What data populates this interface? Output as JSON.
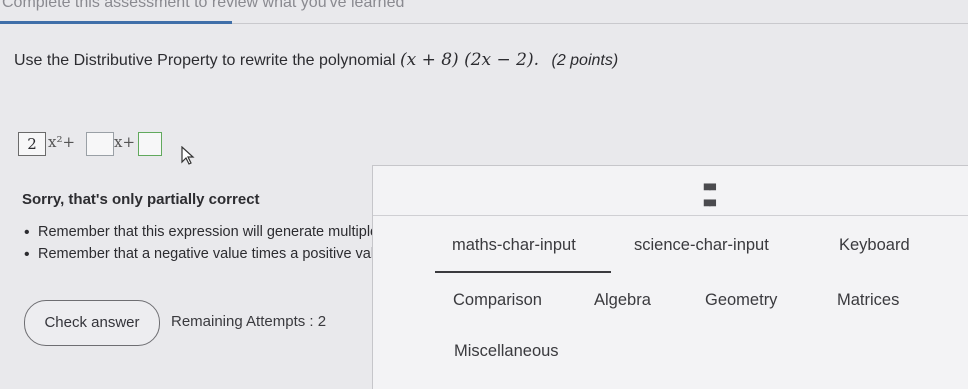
{
  "banner": {
    "text": "Complete this assessment to review what you've learned"
  },
  "question": {
    "text": "Use the Distributive Property to rewrite the polynomial",
    "expression": "(x + 8) (2x − 2).",
    "points": "(2 points)"
  },
  "answer": {
    "box1_value": "2",
    "term1": "x²+",
    "box2_value": "",
    "term2": "x+",
    "box3_value": ""
  },
  "feedback": {
    "title": "Sorry, that's only partially correct",
    "hints": [
      "Remember that this expression will generate multiple terms",
      "Remember that a negative value times a positive value is negative"
    ]
  },
  "actions": {
    "check_label": "Check answer",
    "attempts_text": "Remaining Attempts : 2"
  },
  "keyboard": {
    "handle_icon": "drag-handle-icon",
    "tabs": [
      "maths-char-input",
      "science-char-input",
      "Keyboard"
    ],
    "active_tab": "maths-char-input",
    "categories": [
      "Comparison",
      "Algebra",
      "Geometry",
      "Matrices",
      "Miscellaneous"
    ]
  }
}
